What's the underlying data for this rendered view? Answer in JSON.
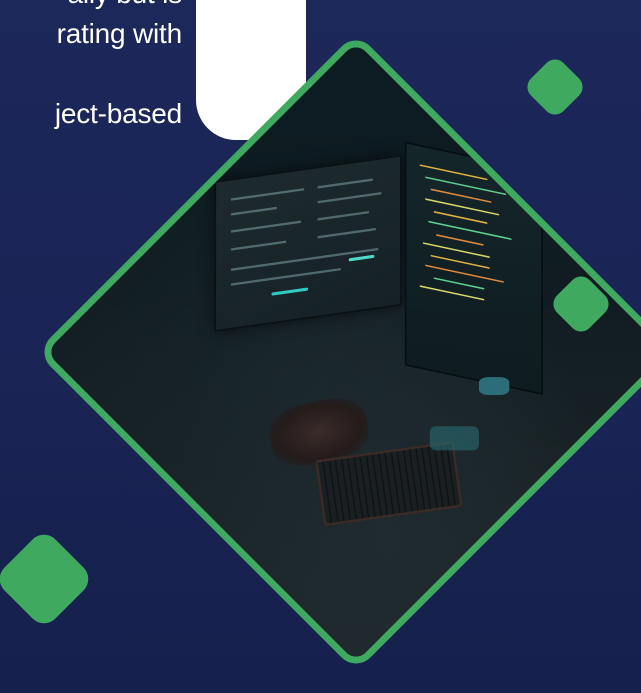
{
  "text": {
    "line1": "ally but is",
    "line2": "rating with",
    "line3": "ject-based"
  },
  "colors": {
    "background": "#1b2557",
    "accent_green": "#3faa5f",
    "card_white": "#ffffff",
    "text": "#ffffff"
  },
  "image": {
    "subject": "developer-workstation-photo"
  }
}
